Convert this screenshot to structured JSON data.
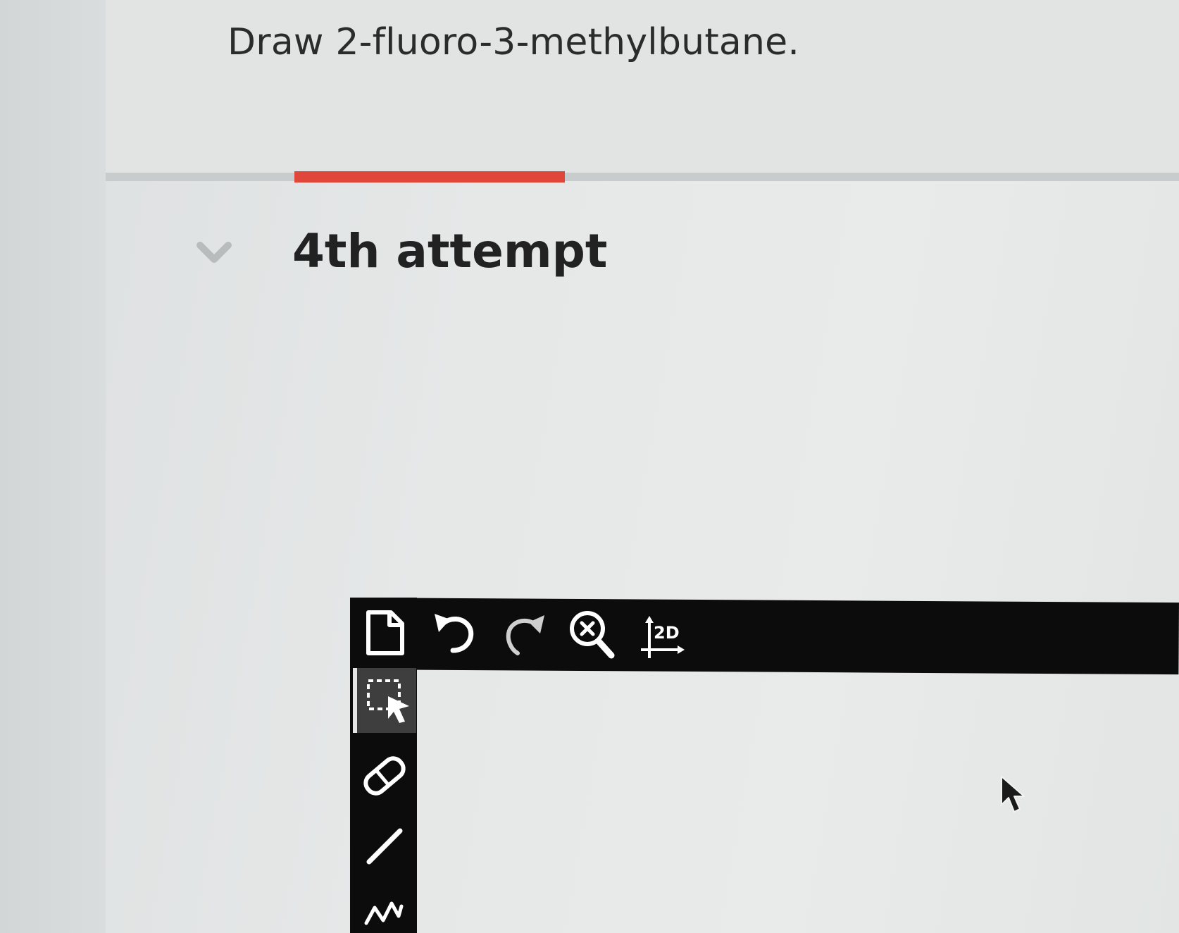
{
  "question": {
    "text": "Draw 2-fluoro-3-methylbutane."
  },
  "attempt": {
    "label": "4th attempt"
  },
  "progress": {
    "fraction": 0.25,
    "color": "#e0463a"
  },
  "toolbar": {
    "top_tools": [
      {
        "name": "new-document-icon"
      },
      {
        "name": "undo-icon"
      },
      {
        "name": "redo-icon"
      },
      {
        "name": "zoom-clear-icon"
      },
      {
        "name": "clean-2d-icon",
        "label": "2D"
      }
    ],
    "left_tools": [
      {
        "name": "select-icon",
        "active": true
      },
      {
        "name": "eraser-icon"
      },
      {
        "name": "single-bond-icon"
      },
      {
        "name": "chain-icon"
      }
    ]
  },
  "colors": {
    "toolbar_bg": "#0c0c0c",
    "icon": "#ffffff",
    "active_tool_bg": "#3e3e3e"
  }
}
